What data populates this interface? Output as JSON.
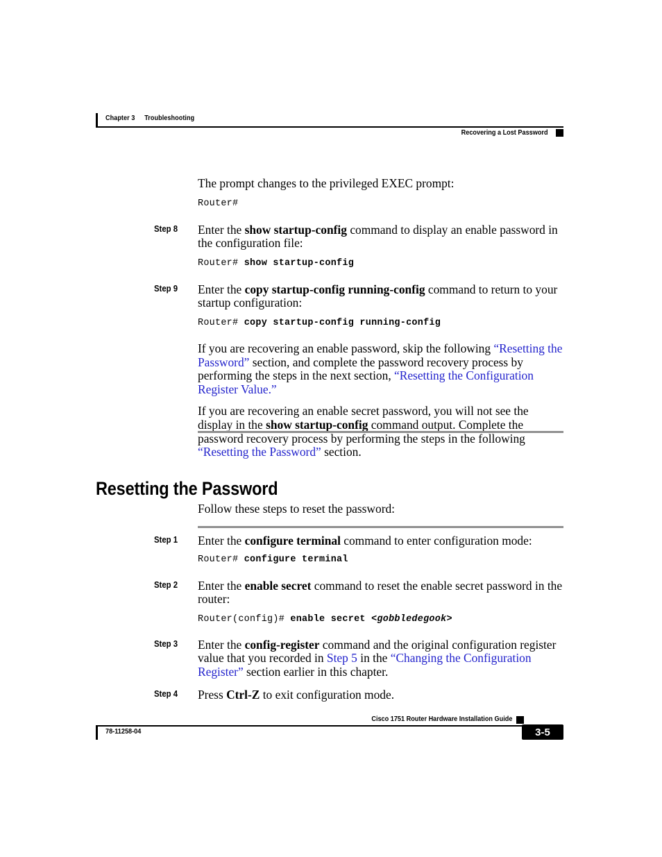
{
  "header": {
    "chapter": "Chapter 3",
    "chapter_title": "Troubleshooting",
    "section": "Recovering a Lost Password"
  },
  "footer": {
    "guide_title": "Cisco 1751 Router Hardware Installation Guide",
    "doc_number": "78-11258-04",
    "page_number": "3-5"
  },
  "colors": {
    "link": "#2222cc",
    "rule_grey": "#8f8f8f",
    "text": "#000000"
  },
  "body": {
    "intro_prompt_text": "The prompt changes to the privileged EXEC prompt:",
    "code_router_prompt": "Router#",
    "step8": {
      "label": "Step 8",
      "text_before": "Enter the ",
      "command": "show startup-config",
      "text_after": " command to display an enable password in the configuration file:",
      "code_prompt": "Router# ",
      "code_command": "show startup-config"
    },
    "step9": {
      "label": "Step 9",
      "text_before": "Enter the ",
      "command": "copy startup-config running-config",
      "text_after": " command to return to your startup configuration:",
      "code_prompt": "Router# ",
      "code_command": "copy startup-config running-config"
    },
    "note_enable_password": {
      "seg1": "If you are recovering an enable password, skip the following ",
      "link1": "“Resetting the Password”",
      "seg2": " section, and complete the password recovery process by performing the steps in the next section, ",
      "link2": "“Resetting the Configuration Register Value.”"
    },
    "note_enable_secret": {
      "seg1": "If you are recovering an enable secret password, you will not see the display in the ",
      "command": "show startup-config",
      "seg2": " command output. Complete the password recovery process by performing the steps in the following ",
      "link1": "“Resetting the Password”",
      "seg3": " section."
    }
  },
  "section_resetting": {
    "heading": "Resetting the Password",
    "intro": "Follow these steps to reset the password:",
    "step1": {
      "label": "Step 1",
      "text_before": "Enter the ",
      "command": "configure terminal",
      "text_after": " command to enter configuration mode:",
      "code_prompt": "Router# ",
      "code_command": "configure terminal"
    },
    "step2": {
      "label": "Step 2",
      "text_before": "Enter the ",
      "command": "enable secret",
      "text_after": " command to reset the enable secret password in the router:",
      "code_prompt": "Router(config)# ",
      "code_command": "enable secret ",
      "code_arg": "<gobbledegook>"
    },
    "step3": {
      "label": "Step 3",
      "text_before": "Enter the ",
      "command": "config-register",
      "text_mid1": " command and the original configuration register value that you recorded in ",
      "link_step5": "Step 5",
      "text_mid2": " in the ",
      "link_section": "“Changing the Configuration Register”",
      "text_after": " section earlier in this chapter."
    },
    "step4": {
      "label": "Step 4",
      "text_before": "Press ",
      "command": "Ctrl-Z",
      "text_after": " to exit configuration mode."
    }
  }
}
